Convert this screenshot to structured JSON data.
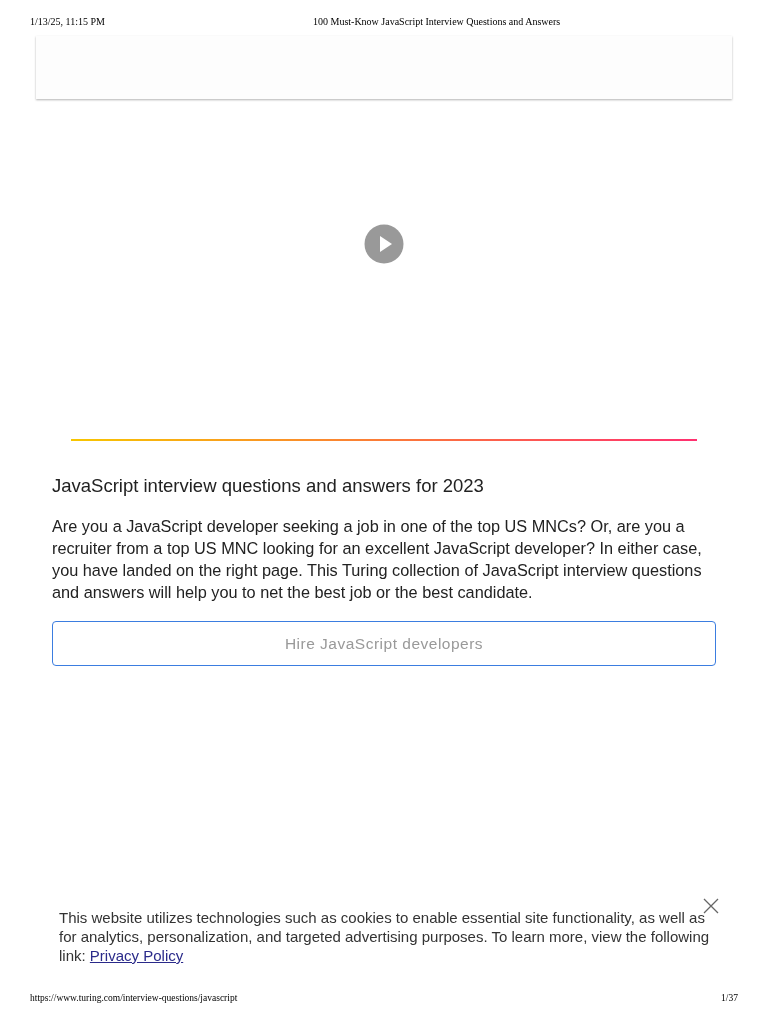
{
  "print_header": {
    "date": "1/13/25, 11:15 PM",
    "title": "100 Must-Know JavaScript Interview Questions and Answers"
  },
  "article": {
    "heading": "JavaScript interview questions and answers for 2023",
    "intro": "Are you a JavaScript developer seeking a job in one of the top US MNCs? Or, are you a recruiter from a top US MNC looking for an excellent JavaScript developer? In either case, you have landed on the right page. This Turing collection of JavaScript interview questions and answers will help you to net the best job or the best candidate.",
    "button": "Hire JavaScript developers"
  },
  "cookie_banner": {
    "text": "This website utilizes technologies such as cookies to enable essential site functionality, as well as for analytics, personalization, and targeted advertising purposes. To learn more, view the following link:",
    "link": "Privacy Policy"
  },
  "print_footer": {
    "url": "https://www.turing.com/interview-questions/javascript",
    "page": "1/37"
  }
}
